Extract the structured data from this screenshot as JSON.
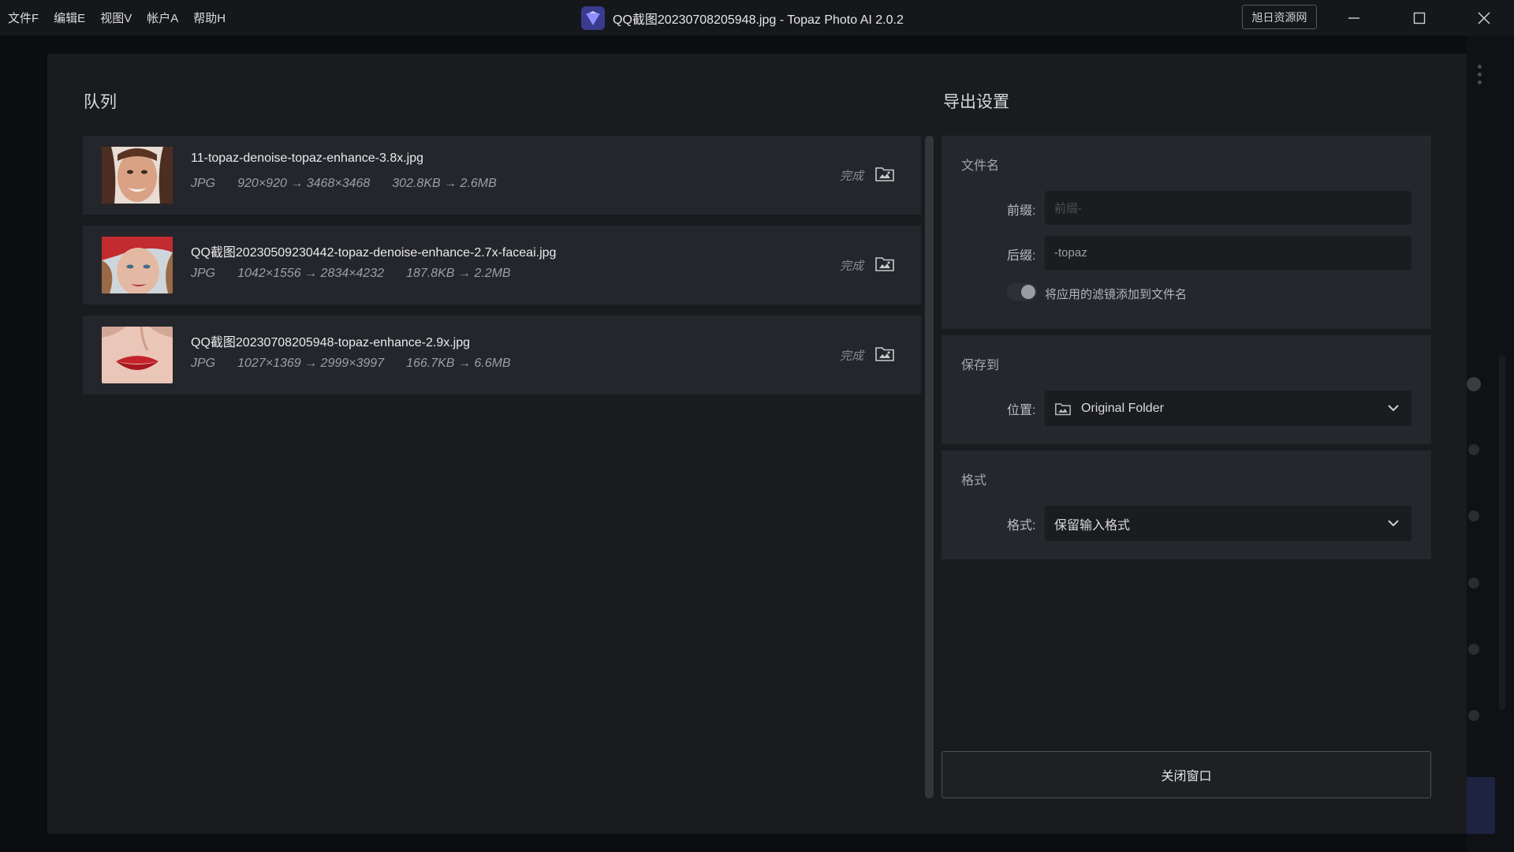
{
  "menu": [
    "文件F",
    "编辑E",
    "视图V",
    "帐户A",
    "帮助H"
  ],
  "window": {
    "title": "QQ截图20230708205948.jpg - Topaz Photo AI 2.0.2",
    "brand_badge": "旭日资源网"
  },
  "queue": {
    "title": "队列",
    "items": [
      {
        "filename": "11-topaz-denoise-topaz-enhance-3.8x.jpg",
        "format": "JPG",
        "dimensions": "920×920 → 3468×3468",
        "size": "302.8KB → 2.6MB",
        "status": "完成"
      },
      {
        "filename": "QQ截图20230509230442-topaz-denoise-enhance-2.7x-faceai.jpg",
        "format": "JPG",
        "dimensions": "1042×1556 → 2834×4232",
        "size": "187.8KB → 2.2MB",
        "status": "完成"
      },
      {
        "filename": "QQ截图20230708205948-topaz-enhance-2.9x.jpg",
        "format": "JPG",
        "dimensions": "1027×1369 → 2999×3997",
        "size": "166.7KB → 6.6MB",
        "status": "完成"
      }
    ]
  },
  "export": {
    "title": "导出设置",
    "filename_section": {
      "title": "文件名",
      "prefix_label": "前缀:",
      "prefix_placeholder": "前缀-",
      "suffix_label": "后缀:",
      "suffix_value": "-topaz",
      "append_filters_label": "将应用的滤镜添加到文件名"
    },
    "save_section": {
      "title": "保存到",
      "location_label": "位置:",
      "location_value": "Original Folder"
    },
    "format_section": {
      "title": "格式",
      "format_label": "格式:",
      "format_value": "保留输入格式"
    },
    "close_button": "关闭窗口"
  },
  "colors": {
    "modal_bg": "#1a1b1f",
    "panel_bg": "#26272c",
    "accent_logo": "#5b5ce8"
  }
}
